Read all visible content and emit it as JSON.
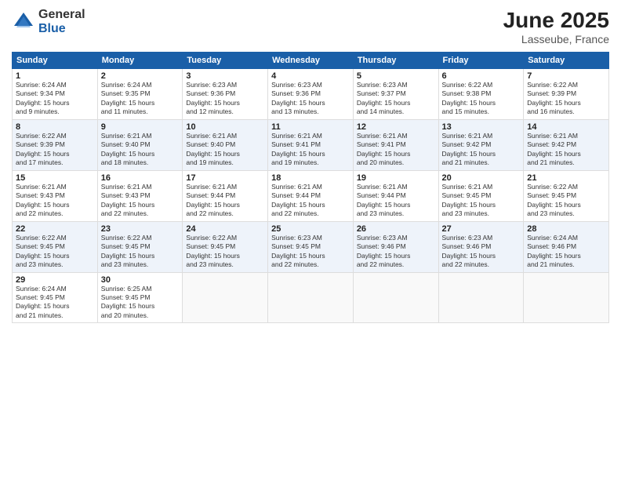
{
  "logo": {
    "general": "General",
    "blue": "Blue"
  },
  "header": {
    "month": "June 2025",
    "location": "Lasseube, France"
  },
  "weekdays": [
    "Sunday",
    "Monday",
    "Tuesday",
    "Wednesday",
    "Thursday",
    "Friday",
    "Saturday"
  ],
  "weeks": [
    [
      {
        "day": "1",
        "info": "Sunrise: 6:24 AM\nSunset: 9:34 PM\nDaylight: 15 hours\nand 9 minutes."
      },
      {
        "day": "2",
        "info": "Sunrise: 6:24 AM\nSunset: 9:35 PM\nDaylight: 15 hours\nand 11 minutes."
      },
      {
        "day": "3",
        "info": "Sunrise: 6:23 AM\nSunset: 9:36 PM\nDaylight: 15 hours\nand 12 minutes."
      },
      {
        "day": "4",
        "info": "Sunrise: 6:23 AM\nSunset: 9:36 PM\nDaylight: 15 hours\nand 13 minutes."
      },
      {
        "day": "5",
        "info": "Sunrise: 6:23 AM\nSunset: 9:37 PM\nDaylight: 15 hours\nand 14 minutes."
      },
      {
        "day": "6",
        "info": "Sunrise: 6:22 AM\nSunset: 9:38 PM\nDaylight: 15 hours\nand 15 minutes."
      },
      {
        "day": "7",
        "info": "Sunrise: 6:22 AM\nSunset: 9:39 PM\nDaylight: 15 hours\nand 16 minutes."
      }
    ],
    [
      {
        "day": "8",
        "info": "Sunrise: 6:22 AM\nSunset: 9:39 PM\nDaylight: 15 hours\nand 17 minutes."
      },
      {
        "day": "9",
        "info": "Sunrise: 6:21 AM\nSunset: 9:40 PM\nDaylight: 15 hours\nand 18 minutes."
      },
      {
        "day": "10",
        "info": "Sunrise: 6:21 AM\nSunset: 9:40 PM\nDaylight: 15 hours\nand 19 minutes."
      },
      {
        "day": "11",
        "info": "Sunrise: 6:21 AM\nSunset: 9:41 PM\nDaylight: 15 hours\nand 19 minutes."
      },
      {
        "day": "12",
        "info": "Sunrise: 6:21 AM\nSunset: 9:41 PM\nDaylight: 15 hours\nand 20 minutes."
      },
      {
        "day": "13",
        "info": "Sunrise: 6:21 AM\nSunset: 9:42 PM\nDaylight: 15 hours\nand 21 minutes."
      },
      {
        "day": "14",
        "info": "Sunrise: 6:21 AM\nSunset: 9:42 PM\nDaylight: 15 hours\nand 21 minutes."
      }
    ],
    [
      {
        "day": "15",
        "info": "Sunrise: 6:21 AM\nSunset: 9:43 PM\nDaylight: 15 hours\nand 22 minutes."
      },
      {
        "day": "16",
        "info": "Sunrise: 6:21 AM\nSunset: 9:43 PM\nDaylight: 15 hours\nand 22 minutes."
      },
      {
        "day": "17",
        "info": "Sunrise: 6:21 AM\nSunset: 9:44 PM\nDaylight: 15 hours\nand 22 minutes."
      },
      {
        "day": "18",
        "info": "Sunrise: 6:21 AM\nSunset: 9:44 PM\nDaylight: 15 hours\nand 22 minutes."
      },
      {
        "day": "19",
        "info": "Sunrise: 6:21 AM\nSunset: 9:44 PM\nDaylight: 15 hours\nand 23 minutes."
      },
      {
        "day": "20",
        "info": "Sunrise: 6:21 AM\nSunset: 9:45 PM\nDaylight: 15 hours\nand 23 minutes."
      },
      {
        "day": "21",
        "info": "Sunrise: 6:22 AM\nSunset: 9:45 PM\nDaylight: 15 hours\nand 23 minutes."
      }
    ],
    [
      {
        "day": "22",
        "info": "Sunrise: 6:22 AM\nSunset: 9:45 PM\nDaylight: 15 hours\nand 23 minutes."
      },
      {
        "day": "23",
        "info": "Sunrise: 6:22 AM\nSunset: 9:45 PM\nDaylight: 15 hours\nand 23 minutes."
      },
      {
        "day": "24",
        "info": "Sunrise: 6:22 AM\nSunset: 9:45 PM\nDaylight: 15 hours\nand 23 minutes."
      },
      {
        "day": "25",
        "info": "Sunrise: 6:23 AM\nSunset: 9:45 PM\nDaylight: 15 hours\nand 22 minutes."
      },
      {
        "day": "26",
        "info": "Sunrise: 6:23 AM\nSunset: 9:46 PM\nDaylight: 15 hours\nand 22 minutes."
      },
      {
        "day": "27",
        "info": "Sunrise: 6:23 AM\nSunset: 9:46 PM\nDaylight: 15 hours\nand 22 minutes."
      },
      {
        "day": "28",
        "info": "Sunrise: 6:24 AM\nSunset: 9:46 PM\nDaylight: 15 hours\nand 21 minutes."
      }
    ],
    [
      {
        "day": "29",
        "info": "Sunrise: 6:24 AM\nSunset: 9:45 PM\nDaylight: 15 hours\nand 21 minutes."
      },
      {
        "day": "30",
        "info": "Sunrise: 6:25 AM\nSunset: 9:45 PM\nDaylight: 15 hours\nand 20 minutes."
      },
      {
        "day": "",
        "info": ""
      },
      {
        "day": "",
        "info": ""
      },
      {
        "day": "",
        "info": ""
      },
      {
        "day": "",
        "info": ""
      },
      {
        "day": "",
        "info": ""
      }
    ]
  ]
}
